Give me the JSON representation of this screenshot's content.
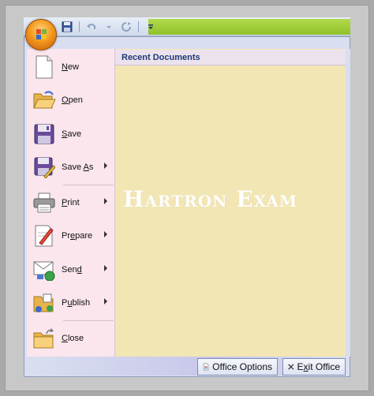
{
  "menu": {
    "recent_header": "Recent Documents",
    "items": [
      {
        "label": "New",
        "key": "N",
        "rest": "ew",
        "icon": "new-document-icon",
        "has_submenu": false
      },
      {
        "label": "Open",
        "key": "O",
        "rest": "pen",
        "icon": "open-folder-icon",
        "has_submenu": false
      },
      {
        "label": "Save",
        "key": "S",
        "rest": "ave",
        "icon": "save-disk-icon",
        "has_submenu": false
      },
      {
        "label": "Save As",
        "key": "A",
        "rest": "",
        "icon": "save-as-icon",
        "has_submenu": true
      },
      {
        "label": "Print",
        "key": "P",
        "rest": "rint",
        "icon": "printer-icon",
        "has_submenu": true
      },
      {
        "label": "Prepare",
        "key": "e",
        "rest": "",
        "icon": "prepare-document-icon",
        "has_submenu": true
      },
      {
        "label": "Send",
        "key": "d",
        "rest": "",
        "icon": "send-mail-icon",
        "has_submenu": true
      },
      {
        "label": "Publish",
        "key": "u",
        "rest": "",
        "icon": "publish-folder-icon",
        "has_submenu": true
      },
      {
        "label": "Close",
        "key": "C",
        "rest": "lose",
        "icon": "close-folder-icon",
        "has_submenu": false
      }
    ],
    "labels_prefix": {
      "save_as": "Save ",
      "prepare": "Pr",
      "prepare_rest": "pare",
      "send": "Sen",
      "publish": "P",
      "publish_rest": "blish"
    }
  },
  "watermark": "Hartron Exam",
  "footer": {
    "options_label": "Office Options",
    "exit_label": "Exit Office",
    "exit_key": "x",
    "exit_prefix": "E",
    "exit_rest": "it Office"
  },
  "colors": {
    "left_pane": "#fbe6ee",
    "right_pane": "#f2e6b4",
    "header_text": "#1e3a73",
    "office_orb": "#f39a1e"
  }
}
